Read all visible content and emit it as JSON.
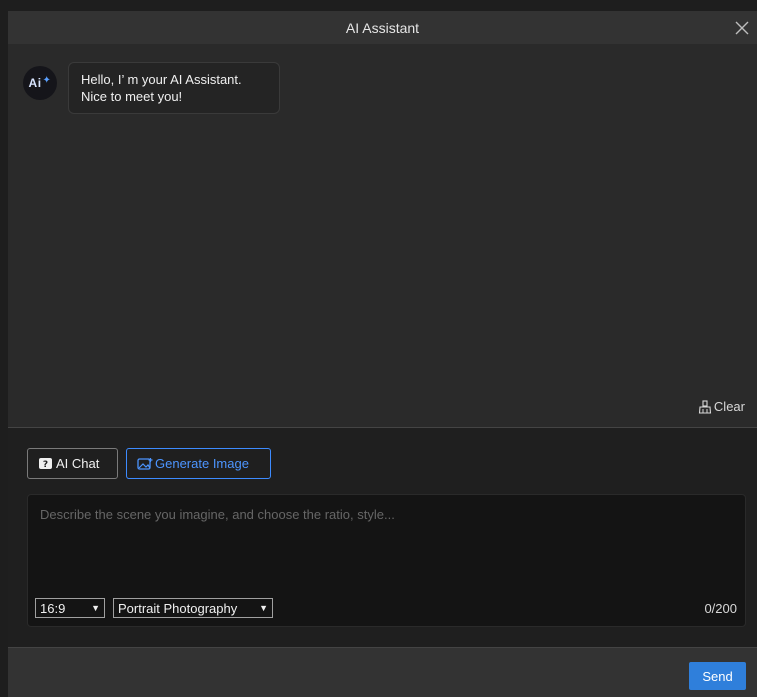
{
  "window": {
    "title": "AI Assistant"
  },
  "chat": {
    "avatar_text": "Ai",
    "messages": [
      {
        "line1": "Hello, I’ m your AI Assistant.",
        "line2": "Nice to meet you!"
      }
    ],
    "clear_label": "Clear"
  },
  "modes": {
    "chat_label": "AI Chat",
    "image_label": "Generate Image",
    "active": "Generate Image"
  },
  "prompt": {
    "placeholder": "Describe the scene you imagine, and choose the ratio, style...",
    "value": "",
    "ratio": "16:9",
    "style": "Portrait Photography",
    "counter": "0/200"
  },
  "footer": {
    "send_label": "Send"
  },
  "colors": {
    "accent": "#2f7fdb",
    "accent_text": "#4c95ff"
  }
}
